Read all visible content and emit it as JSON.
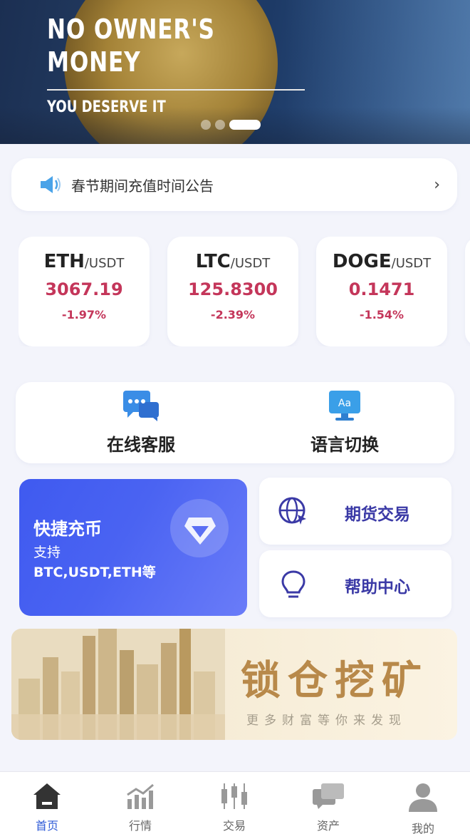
{
  "banner": {
    "title_line1": "NO OWNER'S",
    "title_line2": "MONEY",
    "subtitle": "YOU DESERVE IT",
    "slides": 3,
    "active_slide": 3
  },
  "notice": {
    "icon": "speaker-icon",
    "text": "春节期间充值时间公告",
    "chevron": "›"
  },
  "tickers": [
    {
      "base": "ETH",
      "quote": "/USDT",
      "price": "3067.19",
      "change": "-1.97%"
    },
    {
      "base": "LTC",
      "quote": "/USDT",
      "price": "125.8300",
      "change": "-2.39%"
    },
    {
      "base": "DOGE",
      "quote": "/USDT",
      "price": "0.1471",
      "change": "-1.54%"
    }
  ],
  "quick_links": {
    "support": {
      "label": "在线客服",
      "icon": "chat-bubble-icon"
    },
    "language": {
      "label": "语言切换",
      "icon": "translate-monitor-icon"
    }
  },
  "deposit": {
    "title": "快捷充币",
    "line1": "支持",
    "line2": "BTC,USDT,ETH等",
    "icon": "gem-icon"
  },
  "side_cards": {
    "futures": {
      "label": "期货交易",
      "icon": "globe-icon"
    },
    "help": {
      "label": "帮助中心",
      "icon": "lightbulb-icon"
    }
  },
  "mining": {
    "title": "锁仓挖矿",
    "subtitle": "更多财富等你来发现"
  },
  "tabbar": [
    {
      "label": "首页",
      "icon": "home-icon",
      "active": true
    },
    {
      "label": "行情",
      "icon": "chart-icon",
      "active": false
    },
    {
      "label": "交易",
      "icon": "candlestick-icon",
      "active": false
    },
    {
      "label": "资产",
      "icon": "wallet-icon",
      "active": false
    },
    {
      "label": "我的",
      "icon": "user-icon",
      "active": false
    }
  ],
  "colors": {
    "accent": "#2f5bd7",
    "down": "#c4365a",
    "deposit_gradient_start": "#3f5af0",
    "label_purple": "#3b3aa6"
  }
}
